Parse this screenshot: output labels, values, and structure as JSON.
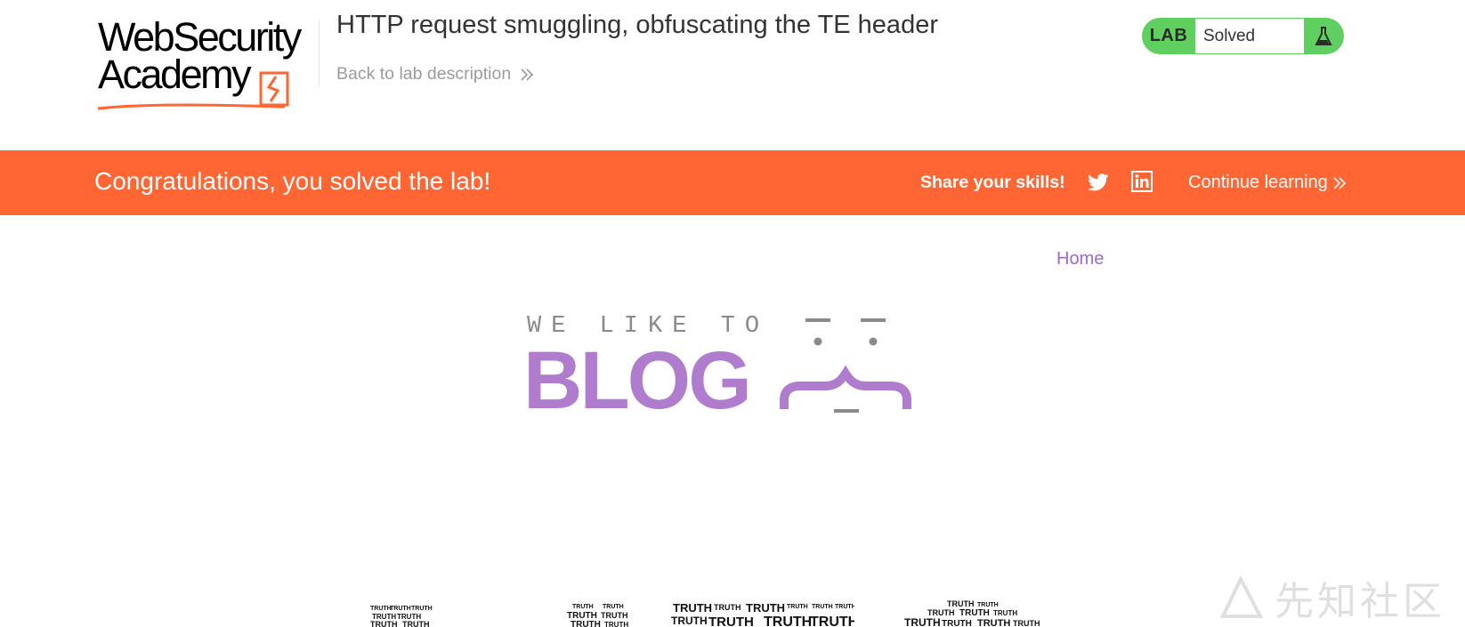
{
  "header": {
    "logo": {
      "line1": "WebSecurity",
      "line2": "Academy"
    },
    "lab_title": "HTTP request smuggling, obfuscating the TE header",
    "back_link": "Back to lab description",
    "status": {
      "label": "LAB",
      "state": "Solved",
      "color": "#5fd05f"
    }
  },
  "banner": {
    "message": "Congratulations, you solved the lab!",
    "share_label": "Share your skills!",
    "social_icons": [
      "twitter-icon",
      "linkedin-icon"
    ],
    "continue_label": "Continue learning",
    "color": "#ff6633"
  },
  "nav": {
    "home": "Home",
    "color": "#9b6ad1"
  },
  "blog_logo": {
    "tagline": "WE LIKE TO",
    "word": "BLOG",
    "color": "#b07ccd"
  },
  "wordcloud_word": "TRUTH",
  "watermark": {
    "text": "先知社区"
  }
}
